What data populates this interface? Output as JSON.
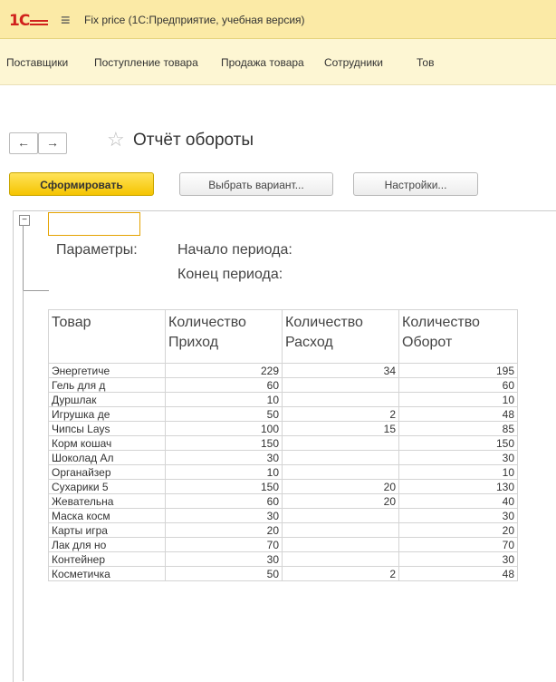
{
  "window": {
    "logo": "1С",
    "title": "Fix price  (1С:Предприятие, учебная версия)"
  },
  "menu": [
    {
      "label": "Поставщики"
    },
    {
      "label": "Поступление товара"
    },
    {
      "label": "Продажа товара"
    },
    {
      "label": "Сотрудники"
    },
    {
      "label": "Тов"
    }
  ],
  "nav": {
    "back": "←",
    "forward": "→",
    "star": "☆"
  },
  "page": {
    "title": "Отчёт обороты"
  },
  "toolbar": {
    "generate": "Сформировать",
    "choose_variant": "Выбрать вариант...",
    "settings": "Настройки..."
  },
  "params": {
    "label": "Параметры:",
    "start": "Начало периода:",
    "end": "Конец периода:"
  },
  "table": {
    "headers": [
      {
        "line1": "Товар",
        "line2": ""
      },
      {
        "line1": "Количество",
        "line2": "Приход"
      },
      {
        "line1": "Количество",
        "line2": "Расход"
      },
      {
        "line1": "Количество",
        "line2": "Оборот"
      }
    ],
    "rows": [
      [
        "Энергетиче",
        "229",
        "34",
        "195"
      ],
      [
        "Гель для д",
        "60",
        "",
        "60"
      ],
      [
        "Дуршлак",
        "10",
        "",
        "10"
      ],
      [
        "Игрушка де",
        "50",
        "2",
        "48"
      ],
      [
        "Чипсы Lays",
        "100",
        "15",
        "85"
      ],
      [
        "Корм кошач",
        "150",
        "",
        "150"
      ],
      [
        "Шоколад Ал",
        "30",
        "",
        "30"
      ],
      [
        "Органайзер",
        "10",
        "",
        "10"
      ],
      [
        "Сухарики 5",
        "150",
        "20",
        "130"
      ],
      [
        "Жевательна",
        "60",
        "20",
        "40"
      ],
      [
        "Маска косм",
        "30",
        "",
        "30"
      ],
      [
        "Карты игра",
        "20",
        "",
        "20"
      ],
      [
        "Лак для но",
        "70",
        "",
        "70"
      ],
      [
        "Контейнер",
        "30",
        "",
        "30"
      ],
      [
        "Косметичка",
        "50",
        "2",
        "48"
      ]
    ]
  }
}
